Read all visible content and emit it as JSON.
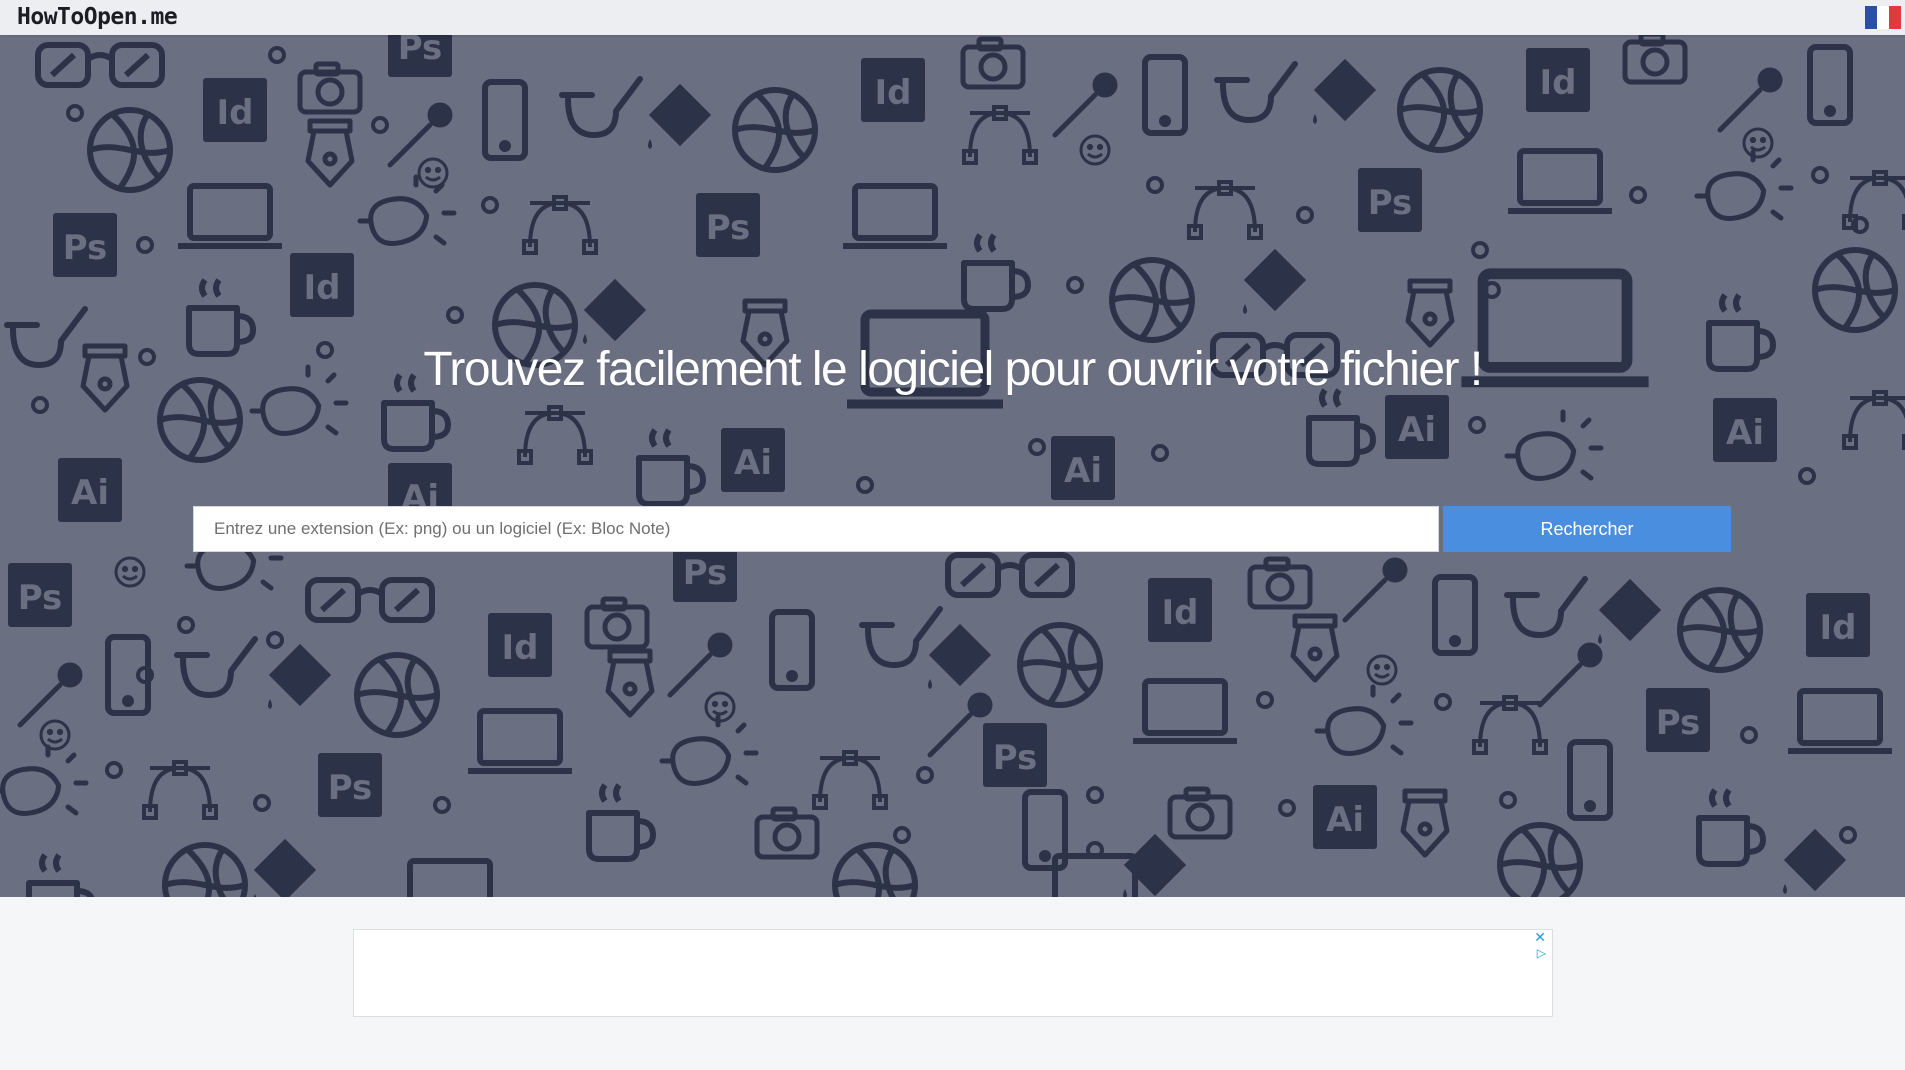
{
  "header": {
    "logo": "HowToOpen.me",
    "language_flag": "france-flag-icon"
  },
  "hero": {
    "title": "Trouvez facilement le logiciel pour ouvrir votre fichier !",
    "search": {
      "placeholder": "Entrez une extension (Ex: png) ou un logiciel (Ex: Bloc Note)",
      "value": "",
      "button_label": "Rechercher"
    }
  },
  "ad": {
    "close_icon": "close-icon",
    "adchoices_icon": "adchoices-icon"
  },
  "colors": {
    "hero_background": "#6b6f82",
    "pattern": "#2c3247",
    "button": "#4a8fdf",
    "topbar": "#eceef1",
    "page_background": "#f5f6f8"
  }
}
